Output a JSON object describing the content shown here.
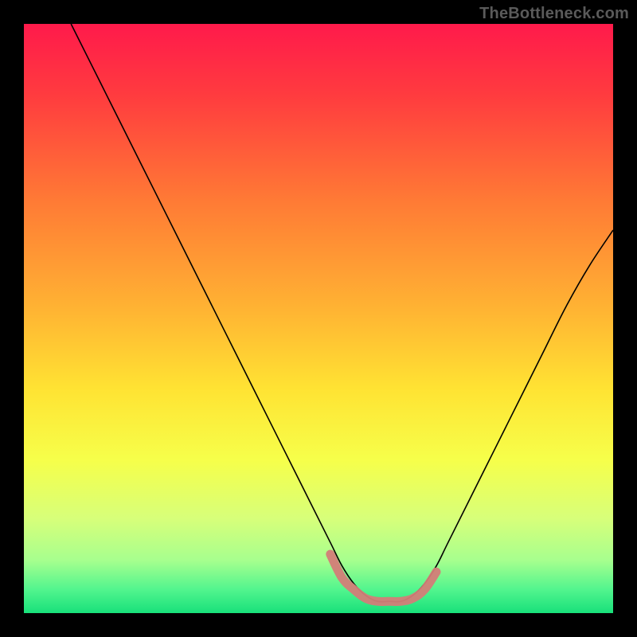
{
  "watermark": "TheBottleneck.com",
  "chart_data": {
    "type": "line",
    "title": "",
    "xlabel": "",
    "ylabel": "",
    "xlim": [
      0,
      100
    ],
    "ylim": [
      0,
      100
    ],
    "background_gradient": {
      "stops": [
        {
          "pos": 0.0,
          "color": "#ff1a4b"
        },
        {
          "pos": 0.12,
          "color": "#ff3b3f"
        },
        {
          "pos": 0.3,
          "color": "#ff7a35"
        },
        {
          "pos": 0.48,
          "color": "#ffb233"
        },
        {
          "pos": 0.62,
          "color": "#ffe333"
        },
        {
          "pos": 0.74,
          "color": "#f6ff4a"
        },
        {
          "pos": 0.84,
          "color": "#d7ff7a"
        },
        {
          "pos": 0.91,
          "color": "#a7ff8e"
        },
        {
          "pos": 0.96,
          "color": "#52f58e"
        },
        {
          "pos": 1.0,
          "color": "#18e07a"
        }
      ]
    },
    "series": [
      {
        "name": "bottleneck-curve",
        "color": "#000000",
        "width": 1.6,
        "x": [
          8,
          12,
          16,
          20,
          24,
          28,
          32,
          36,
          40,
          44,
          48,
          52,
          54,
          56,
          58,
          60,
          62,
          64,
          66,
          68,
          70,
          72,
          76,
          80,
          84,
          88,
          92,
          96,
          100
        ],
        "y": [
          100,
          92,
          84,
          76,
          68,
          60,
          52,
          44,
          36,
          28,
          20,
          12,
          8,
          5,
          3,
          2,
          2,
          2,
          3,
          5,
          8,
          12,
          20,
          28,
          36,
          44,
          52,
          59,
          65
        ]
      }
    ],
    "highlight": {
      "name": "optimal-range",
      "color": "#d37d78",
      "opacity": 0.95,
      "stroke_width": 11,
      "cap": "round",
      "x": [
        52,
        54,
        56,
        58,
        60,
        62,
        64,
        66,
        68,
        70
      ],
      "y": [
        10,
        6,
        4,
        2.5,
        2,
        2,
        2,
        2.5,
        4,
        7
      ]
    }
  }
}
